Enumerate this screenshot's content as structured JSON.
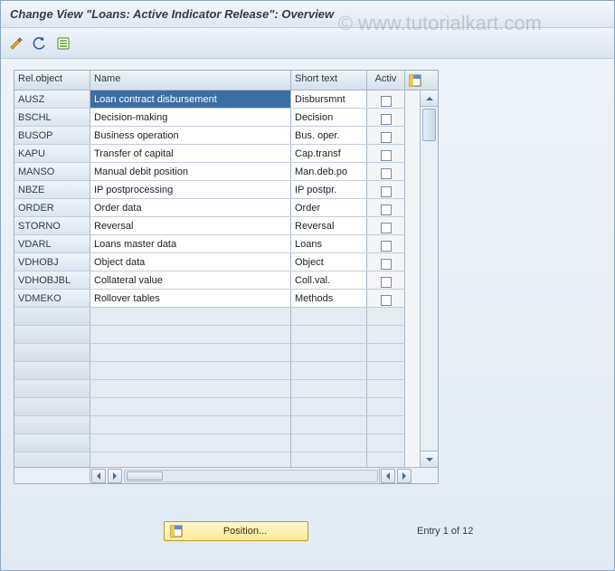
{
  "title": "Change View \"Loans: Active Indicator Release\": Overview",
  "toolbar": {
    "pencil_icon": "edit-icon",
    "undo_icon": "undo-icon",
    "select_icon": "select-all-icon"
  },
  "columns": {
    "rel": "Rel.object",
    "name": "Name",
    "short": "Short text",
    "activ": "Activ"
  },
  "config_icon": "table-settings-icon",
  "rows": [
    {
      "rel": "AUSZ",
      "name": "Loan contract disbursement",
      "short": "Disbursmnt",
      "highlight": true
    },
    {
      "rel": "BSCHL",
      "name": "Decision-making",
      "short": "Decision"
    },
    {
      "rel": "BUSOP",
      "name": "Business operation",
      "short": "Bus. oper."
    },
    {
      "rel": "KAPU",
      "name": "Transfer of capital",
      "short": "Cap.transf"
    },
    {
      "rel": "MANSO",
      "name": "Manual debit position",
      "short": "Man.deb.po"
    },
    {
      "rel": "NBZE",
      "name": "IP postprocessing",
      "short": "IP postpr."
    },
    {
      "rel": "ORDER",
      "name": "Order data",
      "short": "Order"
    },
    {
      "rel": "STORNO",
      "name": "Reversal",
      "short": "Reversal"
    },
    {
      "rel": "VDARL",
      "name": "Loans master data",
      "short": "Loans"
    },
    {
      "rel": "VDHOBJ",
      "name": "Object data",
      "short": "Object"
    },
    {
      "rel": "VDHOBJBL",
      "name": "Collateral value",
      "short": "Coll.val."
    },
    {
      "rel": "VDMEKO",
      "name": "Rollover tables",
      "short": "Methods"
    }
  ],
  "empty_rows": 9,
  "footer": {
    "position_label": "Position...",
    "entry_text": "Entry 1 of 12"
  }
}
